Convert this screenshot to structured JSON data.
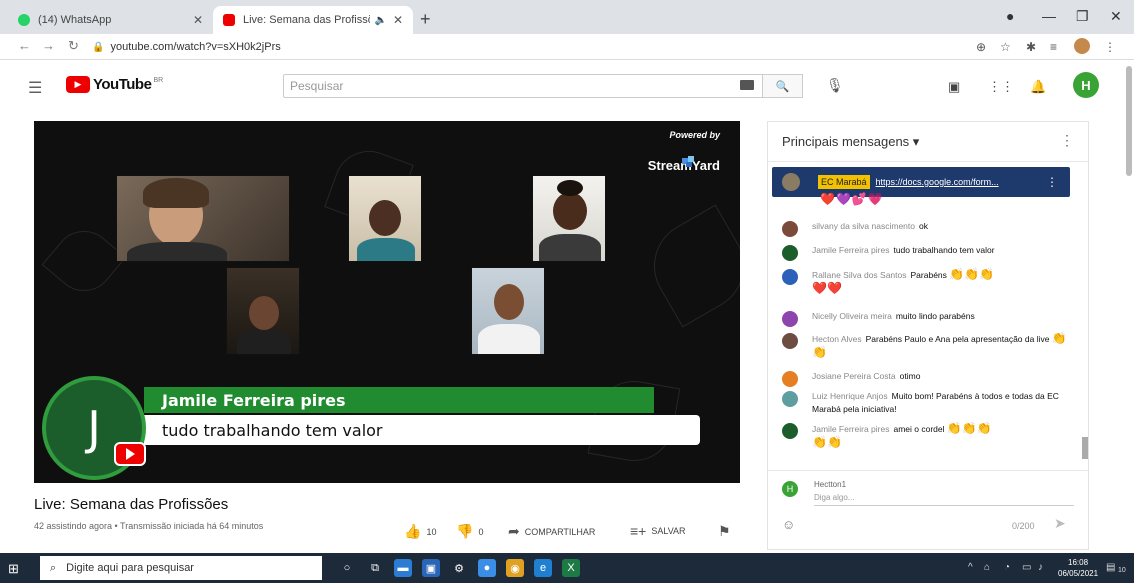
{
  "browser": {
    "tabs": [
      {
        "title": "(14) WhatsApp"
      },
      {
        "title": "Live: Semana das Profissõe:"
      }
    ],
    "new_tab": "+",
    "url": "youtube.com/watch?v=sXH0k2jPrs"
  },
  "youtube": {
    "logo_text": "YouTube",
    "logo_sup": "BR",
    "search_placeholder": "Pesquisar",
    "user_initial": "H"
  },
  "video": {
    "powered_by": "Powered by",
    "brand": "StreamYard",
    "lower_third": {
      "initial": "J",
      "name": "Jamile Ferreira pires",
      "message": "tudo trabalhando tem valor"
    },
    "title": "Live: Semana das Profissões",
    "meta": "42 assistindo agora • Transmissão iniciada há 64 minutos",
    "likes": "10",
    "dislikes": "0",
    "share_label": "COMPARTILHAR",
    "save_label": "SALVAR"
  },
  "chat": {
    "header": "Principais mensagens ▾",
    "pinned": {
      "author": "EC Marabá",
      "text": "https://docs.google.com/form..."
    },
    "pinned_hearts": "❤️💜💕💗",
    "messages": [
      {
        "author": "silvany da silva nascimento",
        "text": "ok",
        "color": "#7b4a3a"
      },
      {
        "author": "Jamile Ferreira pires",
        "text": "tudo trabalhando tem valor",
        "color": "#1b5e2b"
      },
      {
        "author": "Rallane Silva dos Santos",
        "text": "Parabéns",
        "color": "#2962b8",
        "emoji": "👏👏👏",
        "emoji2": "❤️❤️"
      },
      {
        "author": "Nicelly Oliveira meira",
        "text": "muito lindo parabéns",
        "color": "#8e44ad"
      },
      {
        "author": "Hecton Alves",
        "text": "Parabéns Paulo e Ana pela apresentação da live",
        "color": "#6d4c41",
        "emoji": "👏👏"
      },
      {
        "author": "Josiane Pereira Costa",
        "text": "otimo",
        "color": "#e67e22"
      },
      {
        "author": "Luiz Henrique Anjos",
        "text": "Muito bom! Parabéns à todos e todas da EC Marabá pela iniciativa!",
        "color": "#5f9ea0"
      },
      {
        "author": "Jamile Ferreira pires",
        "text": "amei o cordel",
        "color": "#1b5e2b",
        "emoji": "👏👏👏",
        "emoji2": "👏👏"
      }
    ],
    "input": {
      "user": "Hectton1",
      "placeholder": "Diga algo...",
      "counter": "0/200",
      "user_initial": "H"
    }
  },
  "taskbar": {
    "search_placeholder": "Digite aqui para pesquisar",
    "time": "16:08",
    "date": "06/05/2021",
    "notifications": "10"
  }
}
